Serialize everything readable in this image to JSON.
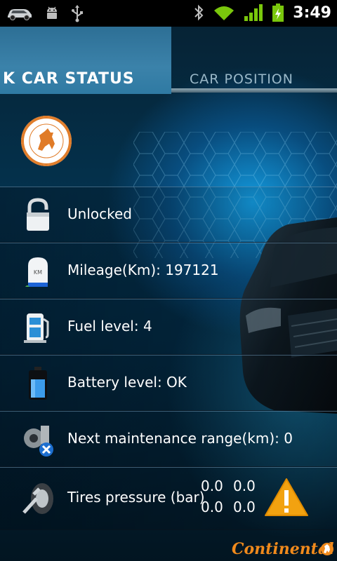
{
  "status_bar": {
    "time": "3:49",
    "icons": [
      "car-icon",
      "android-debug-icon",
      "usb-icon",
      "bluetooth-icon",
      "wifi-icon",
      "signal-icon",
      "battery-charging-icon"
    ]
  },
  "tabs": [
    {
      "label": "K CAR STATUS",
      "active": true
    },
    {
      "label": "CAR POSITION",
      "active": false
    }
  ],
  "logo": {
    "name": "continental-logo",
    "text": "CONTINENTAL"
  },
  "rows": [
    {
      "label": "Unlocked",
      "icon": "padlock-unlocked-icon"
    },
    {
      "label": "Mileage(Km): 197121",
      "icon": "mileage-icon",
      "badge": "KM"
    },
    {
      "label": "Fuel level: 4",
      "icon": "fuel-pump-icon"
    },
    {
      "label": "Battery level: OK",
      "icon": "battery-icon"
    },
    {
      "label": "Next maintenance range(km): 0",
      "icon": "maintenance-icon"
    },
    {
      "label": "Tires pressure (bar)",
      "icon": "tire-pressure-icon",
      "values": [
        "0.0",
        "0.0",
        "0.0",
        "0.0"
      ],
      "warning": true
    }
  ],
  "brand": "Continental",
  "colors": {
    "accent": "#3b82aa",
    "brand": "#f08a1c",
    "warning": "#f2a210"
  }
}
